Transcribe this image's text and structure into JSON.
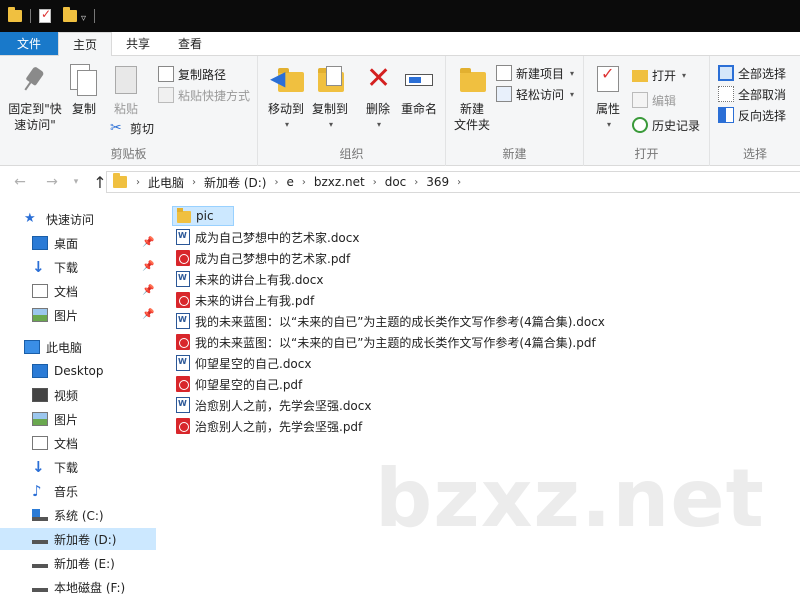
{
  "ribbon_tabs": [
    "文件",
    "主页",
    "共享",
    "查看"
  ],
  "ribbon": {
    "clipboard": {
      "pin_label_line1": "固定到\"快",
      "pin_label_line2": "速访问\"",
      "copy": "复制",
      "paste": "粘贴",
      "copy_path": "复制路径",
      "paste_shortcut": "粘贴快捷方式",
      "cut": "剪切",
      "group": "剪贴板"
    },
    "organize": {
      "move_to": "移动到",
      "copy_to": "复制到",
      "delete": "删除",
      "rename": "重命名",
      "group": "组织"
    },
    "new": {
      "new_folder_line1": "新建",
      "new_folder_line2": "文件夹",
      "new_item": "新建项目",
      "easy_access": "轻松访问",
      "group": "新建"
    },
    "open": {
      "properties": "属性",
      "open": "打开",
      "edit": "编辑",
      "history": "历史记录",
      "group": "打开"
    },
    "select": {
      "select_all": "全部选择",
      "select_none": "全部取消",
      "invert": "反向选择",
      "group": "选择"
    }
  },
  "address": {
    "breadcrumbs": [
      "此电脑",
      "新加卷 (D:)",
      "e",
      "bzxz.net",
      "doc",
      "369"
    ]
  },
  "sidebar": {
    "items": [
      {
        "label": "快速访问",
        "icon": "star-icon",
        "pinned": false
      },
      {
        "label": "桌面",
        "icon": "desktop-icon",
        "pinned": true
      },
      {
        "label": "下载",
        "icon": "download-icon",
        "pinned": true
      },
      {
        "label": "文档",
        "icon": "documents-icon",
        "pinned": true
      },
      {
        "label": "图片",
        "icon": "pictures-icon",
        "pinned": true
      },
      {
        "label": "此电脑",
        "icon": "computer-icon",
        "pinned": false
      },
      {
        "label": "Desktop",
        "icon": "desktop-icon",
        "pinned": false
      },
      {
        "label": "视频",
        "icon": "videos-icon",
        "pinned": false
      },
      {
        "label": "图片",
        "icon": "pictures-icon",
        "pinned": false
      },
      {
        "label": "文档",
        "icon": "documents-icon",
        "pinned": false
      },
      {
        "label": "下载",
        "icon": "download-icon",
        "pinned": false
      },
      {
        "label": "音乐",
        "icon": "music-icon",
        "pinned": false
      },
      {
        "label": "系统 (C:)",
        "icon": "system-drive-icon",
        "pinned": false
      },
      {
        "label": "新加卷 (D:)",
        "icon": "drive-icon",
        "pinned": false,
        "selected": true
      },
      {
        "label": "新加卷 (E:)",
        "icon": "drive-icon",
        "pinned": false
      },
      {
        "label": "本地磁盘 (F:)",
        "icon": "drive-icon",
        "pinned": false
      }
    ]
  },
  "files": [
    {
      "name": "pic",
      "type": "folder",
      "selected": true
    },
    {
      "name": "成为自己梦想中的艺术家.docx",
      "type": "word"
    },
    {
      "name": "成为自己梦想中的艺术家.pdf",
      "type": "pdf"
    },
    {
      "name": "未来的讲台上有我.docx",
      "type": "word"
    },
    {
      "name": "未来的讲台上有我.pdf",
      "type": "pdf"
    },
    {
      "name": "我的未来蓝图：以“未来的自已”为主题的成长类作文写作参考(4篇合集).docx",
      "type": "word"
    },
    {
      "name": "我的未来蓝图：以“未来的自已”为主题的成长类作文写作参考(4篇合集).pdf",
      "type": "pdf"
    },
    {
      "name": "仰望星空的自己.docx",
      "type": "word"
    },
    {
      "name": "仰望星空的自己.pdf",
      "type": "pdf"
    },
    {
      "name": "治愈别人之前，先学会坚强.docx",
      "type": "word"
    },
    {
      "name": "治愈别人之前，先学会坚强.pdf",
      "type": "pdf"
    }
  ],
  "watermark": "bzxz.net"
}
